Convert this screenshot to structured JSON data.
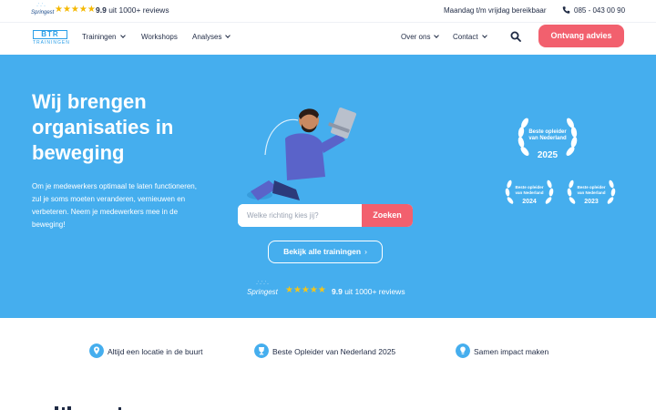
{
  "topbar": {
    "springest_logo_text": "Springest",
    "rating_stars": "★★★★★",
    "rating_score": "9.9",
    "rating_text": " uit 1000+ reviews",
    "hours": "Maandag t/m vrijdag bereikbaar",
    "phone": "085 - 043 00 90"
  },
  "nav": {
    "logo_text": "BTR",
    "logo_sub": "TRAININGEN",
    "items": [
      {
        "label": "Trainingen",
        "has_dropdown": true
      },
      {
        "label": "Workshops",
        "has_dropdown": false
      },
      {
        "label": "Analyses",
        "has_dropdown": true
      },
      {
        "label": "Over ons",
        "has_dropdown": true
      },
      {
        "label": "Contact",
        "has_dropdown": true
      }
    ],
    "cta_label": "Ontvang advies"
  },
  "hero": {
    "title": "Wij brengen organisaties in beweging",
    "intro": "Om je medewerkers optimaal te laten functioneren, zul je soms moeten veranderen, vernieuwen en verbeteren. Neem je medewerkers mee in de beweging!",
    "search_placeholder": "Welke richting kies jij?",
    "search_button": "Zoeken",
    "all_trainings_label": "Bekijk alle trainingen",
    "all_trainings_arrow": "›",
    "springest_logo_text": "Springest",
    "rating_stars": "★★★★★",
    "rating_score": "9.9",
    "rating_text": " uit 1000+ reviews",
    "awards": [
      {
        "line1": "Beste opleider",
        "line2": "van Nederland",
        "year": "2025"
      },
      {
        "line1": "Beste opleider",
        "line2": "van Nederland",
        "year": "2024"
      },
      {
        "line1": "Beste opleider",
        "line2": "van Nederland",
        "year": "2023"
      }
    ]
  },
  "features": [
    {
      "icon": "location-pin-icon",
      "label": "Altijd een locatie in de buurt"
    },
    {
      "icon": "trophy-icon",
      "label": "Beste Opleider van Nederland 2025"
    },
    {
      "icon": "lightbulb-icon",
      "label": "Samen impact maken"
    }
  ],
  "colors": {
    "hero_bg": "#45aeee",
    "accent": "#f2606e",
    "text": "#1f2a44",
    "star": "#f5b800"
  }
}
